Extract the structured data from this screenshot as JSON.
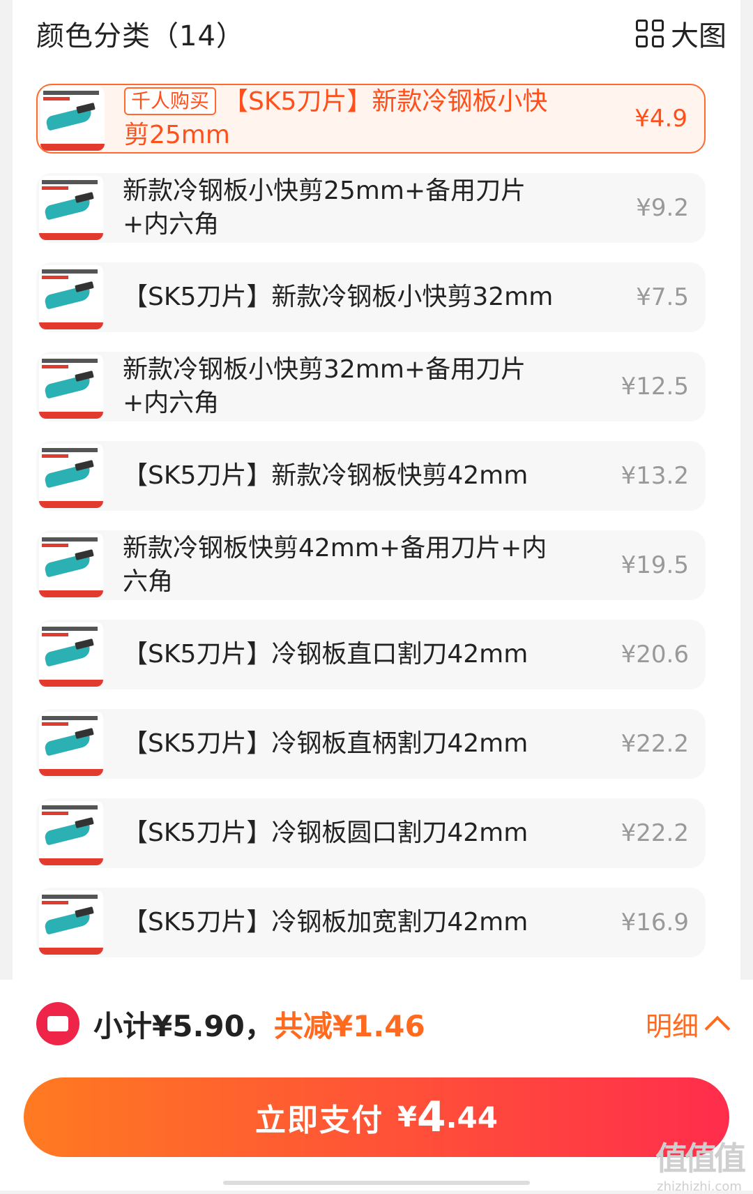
{
  "header": {
    "title": "颜色分类（14）",
    "view_toggle_label": "大图"
  },
  "skus": [
    {
      "tag": "千人购买",
      "name": "【SK5刀片】新款冷钢板小快剪25mm",
      "price": "¥4.9",
      "selected": true
    },
    {
      "name": "新款冷钢板小快剪25mm+备用刀片+内六角",
      "price": "¥9.2"
    },
    {
      "name": "【SK5刀片】新款冷钢板小快剪32mm",
      "price": "¥7.5"
    },
    {
      "name": "新款冷钢板小快剪32mm+备用刀片+内六角",
      "price": "¥12.5"
    },
    {
      "name": "【SK5刀片】新款冷钢板快剪42mm",
      "price": "¥13.2"
    },
    {
      "name": "新款冷钢板快剪42mm+备用刀片+内六角",
      "price": "¥19.5"
    },
    {
      "name": "【SK5刀片】冷钢板直口割刀42mm",
      "price": "¥20.6"
    },
    {
      "name": "【SK5刀片】冷钢板直柄割刀42mm",
      "price": "¥22.2"
    },
    {
      "name": "【SK5刀片】冷钢板圆口割刀42mm",
      "price": "¥22.2"
    },
    {
      "name": "【SK5刀片】冷钢板加宽割刀42mm",
      "price": "¥16.9"
    }
  ],
  "summary": {
    "subtotal": "小计¥5.90，",
    "discount": "共减¥1.46",
    "detail_label": "明细"
  },
  "pay": {
    "label": "立即支付",
    "currency": "¥",
    "amount_int": "4",
    "amount_dec": ".44"
  },
  "watermark": {
    "logo": "值值值",
    "site": "zhizhizhi.com"
  },
  "colors": {
    "accent": "#ff6a2c",
    "pay_gradient_start": "#ff7a21",
    "pay_gradient_end": "#ff2d4c",
    "coupon_red": "#ee2449"
  }
}
